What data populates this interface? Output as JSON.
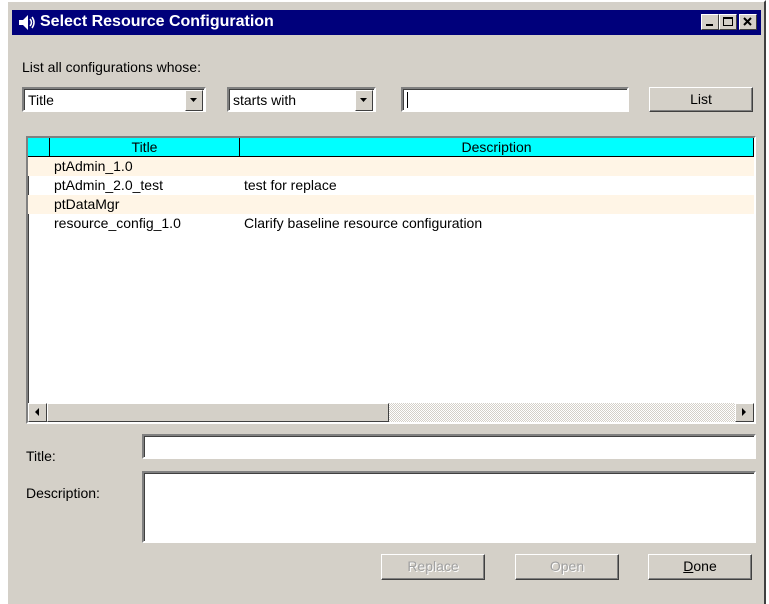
{
  "window": {
    "title": "Select Resource Configuration"
  },
  "filter": {
    "prompt": "List all configurations whose:",
    "field_value": "Title",
    "operator_value": "starts with",
    "search_value": "",
    "list_label": "List"
  },
  "table": {
    "columns": [
      "Title",
      "Description"
    ],
    "rows": [
      {
        "title": "ptAdmin_1.0",
        "description": ""
      },
      {
        "title": "ptAdmin_2.0_test",
        "description": "test for replace"
      },
      {
        "title": "ptDataMgr",
        "description": ""
      },
      {
        "title": "resource_config_1.0",
        "description": "Clarify baseline resource configuration"
      }
    ]
  },
  "details": {
    "title_label": "Title:",
    "title_value": "",
    "description_label": "Description:",
    "description_value": ""
  },
  "buttons": {
    "replace": "Replace",
    "open": "Open",
    "done_underlined": "D",
    "done_rest": "one"
  },
  "colors": {
    "titlebar": "#00007b",
    "header": "#00ffff",
    "row_alt": "#fff5e6"
  }
}
